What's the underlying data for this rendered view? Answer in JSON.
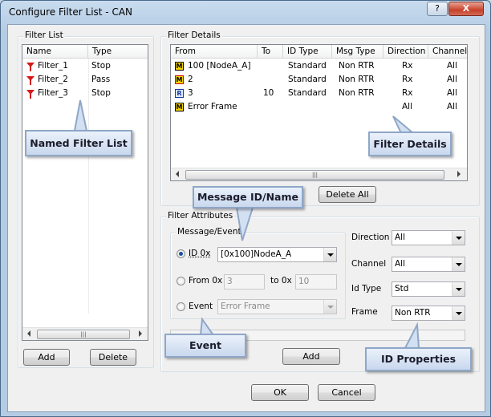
{
  "window": {
    "title": "Configure Filter List - CAN",
    "help_label": "?",
    "close_label": "X"
  },
  "filter_list": {
    "group_label": "Filter List",
    "columns": [
      "Name",
      "Type"
    ],
    "rows": [
      {
        "name": "Filter_1",
        "type": "Stop"
      },
      {
        "name": "Filter_2",
        "type": "Pass"
      },
      {
        "name": "Filter_3",
        "type": "Stop"
      }
    ],
    "scroll_thumb": "|||",
    "add_label": "Add",
    "delete_label": "Delete"
  },
  "filter_details": {
    "group_label": "Filter Details",
    "columns": [
      "From",
      "To",
      "ID Type",
      "Msg Type",
      "Direction",
      "Channel"
    ],
    "rows": [
      {
        "icon": "M",
        "from": "100 [NodeA_A]",
        "to": "",
        "id_type": "Standard",
        "msg_type": "Non RTR",
        "direction": "Rx",
        "channel": "All"
      },
      {
        "icon": "M",
        "from": "2",
        "to": "",
        "id_type": "Standard",
        "msg_type": "Non RTR",
        "direction": "Rx",
        "channel": "All"
      },
      {
        "icon": "R",
        "from": "3",
        "to": "10",
        "id_type": "Standard",
        "msg_type": "Non RTR",
        "direction": "Rx",
        "channel": "All"
      },
      {
        "icon": "M",
        "from": "Error Frame",
        "to": "",
        "id_type": "",
        "msg_type": "",
        "direction": "All",
        "channel": "All"
      }
    ],
    "scroll_thumb": "|||",
    "delete_all_label": "Delete All"
  },
  "filter_attributes": {
    "group_label": "Filter Attributes",
    "message_event": {
      "group_label": "Message/Event",
      "id_label": "ID  0x",
      "id_value": "[0x100]NodeA_A",
      "from_label": "From 0x",
      "from_value": "3",
      "to_label": "to 0x",
      "to_value": "10",
      "event_label": "Event",
      "event_value": "Error Frame"
    },
    "direction_label": "Direction",
    "direction_value": "All",
    "channel_label": "Channel",
    "channel_value": "All",
    "id_type_label": "Id Type",
    "id_type_value": "Std",
    "frame_label": "Frame",
    "frame_value": "Non RTR",
    "add_label": "Add"
  },
  "footer": {
    "ok_label": "OK",
    "cancel_label": "Cancel"
  },
  "callouts": {
    "named_filter_list": "Named Filter List",
    "filter_details": "Filter Details",
    "message_id_name": "Message ID/Name",
    "event": "Event",
    "id_properties": "ID Properties"
  }
}
